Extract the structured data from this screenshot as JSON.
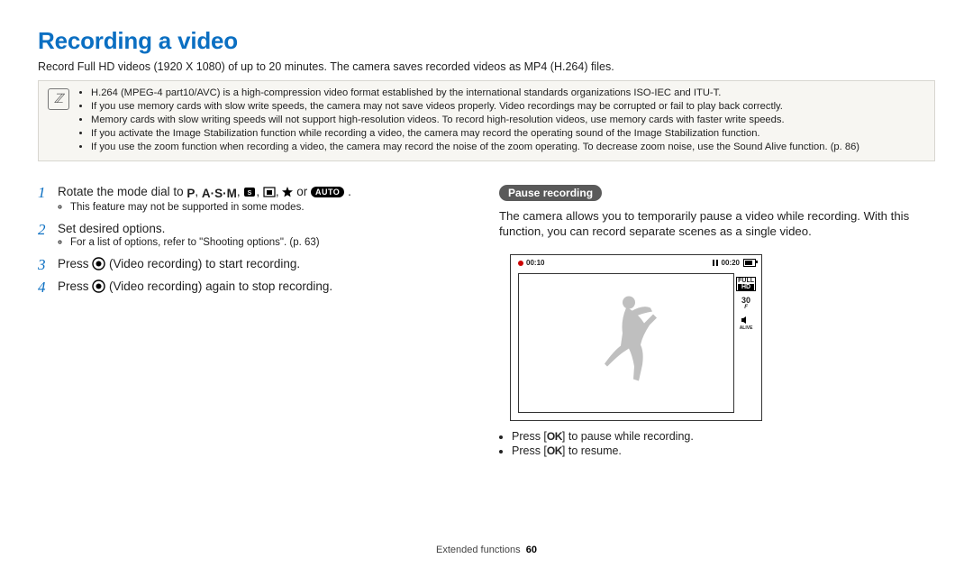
{
  "title": "Recording a video",
  "subtitle": "Record Full HD videos (1920 X 1080) of up to 20 minutes. The camera saves recorded videos as MP4 (H.264) files.",
  "info_notes": [
    "H.264 (MPEG-4 part10/AVC) is a high-compression video format established by the international standards organizations ISO-IEC and ITU-T.",
    "If you use memory cards with slow write speeds, the camera may not save videos properly. Video recordings may be corrupted or fail to play back correctly.",
    "Memory cards with slow writing speeds will not support high-resolution videos. To record high-resolution videos, use memory cards with faster write speeds.",
    "If you activate the Image Stabilization function while recording a video, the camera may record the operating sound of the Image Stabilization function.",
    "If you use the zoom function when recording a video, the camera may record the noise of the zoom operating. To decrease zoom noise, use the Sound Alive function. (p. 86)"
  ],
  "steps": {
    "s1_a": "Rotate the mode dial to ",
    "s1_b": " or ",
    "s1_c": " .",
    "s1_note": "This feature may not be supported in some modes.",
    "s2": "Set desired options.",
    "s2_note": "For a list of options, refer to \"Shooting options\". (p. 63)",
    "s3_a": "Press ",
    "s3_b": " (Video recording) to start recording.",
    "s4_a": "Press ",
    "s4_b": " (Video recording) again to stop recording."
  },
  "modes": {
    "p": "P",
    "asm": "A·S·M",
    "auto": "AUTO"
  },
  "pause": {
    "header": "Pause recording",
    "desc": "The camera allows you to temporarily pause a video while recording. With this function, you can record separate scenes as a single video.",
    "a1_pre": "Press [",
    "a1_post": "] to pause while recording.",
    "a2_pre": "Press [",
    "a2_post": "] to resume.",
    "ok": "OK"
  },
  "screen": {
    "time_elapsed": "00:10",
    "time_remaining": "00:20",
    "full": "FULL",
    "hd": "HD",
    "fps": "30",
    "alive": "ALIVE"
  },
  "footer": {
    "section": "Extended functions",
    "page": "60"
  }
}
